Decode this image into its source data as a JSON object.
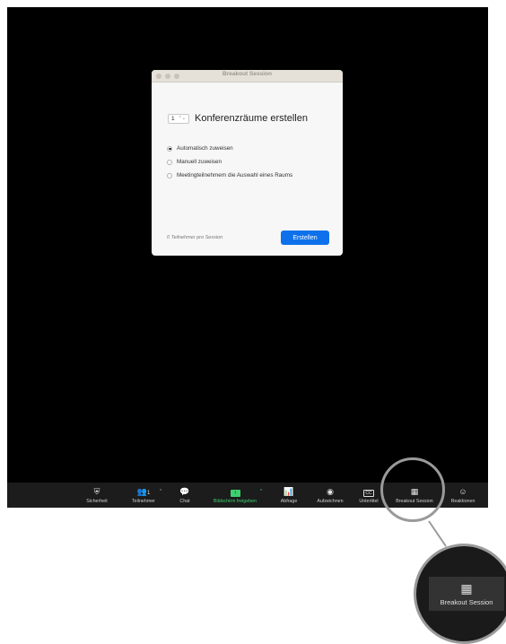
{
  "dialog": {
    "title": "Breakout Session",
    "room_count": "1",
    "room_label": "Konferenzräume erstellen",
    "options": [
      {
        "label": "Automatisch zuweisen",
        "checked": true
      },
      {
        "label": "Manuell zuweisen",
        "checked": false
      },
      {
        "label": "Meetingteilnehmern die Auswahl eines Raums",
        "checked": false
      }
    ],
    "participants_note": "0 Teilnehmer pro Session",
    "create_button": "Erstellen"
  },
  "toolbar": {
    "security": "Sicherheit",
    "participants": "Teilnehmer",
    "participants_count": "1",
    "chat": "Chat",
    "share_screen": "Bildschirm freigeben",
    "poll": "Abfrage",
    "record": "Aufzeichnen",
    "subtitles": "Untertitel",
    "cc_icon_text": "CC",
    "breakout": "Breakout Session",
    "reactions": "Reaktionen"
  },
  "magnifier": {
    "label": "Breakout Session"
  },
  "colors": {
    "accent": "#0e71eb",
    "share_green": "#3bd16f",
    "toolbar_bg": "#1c1c1c"
  }
}
